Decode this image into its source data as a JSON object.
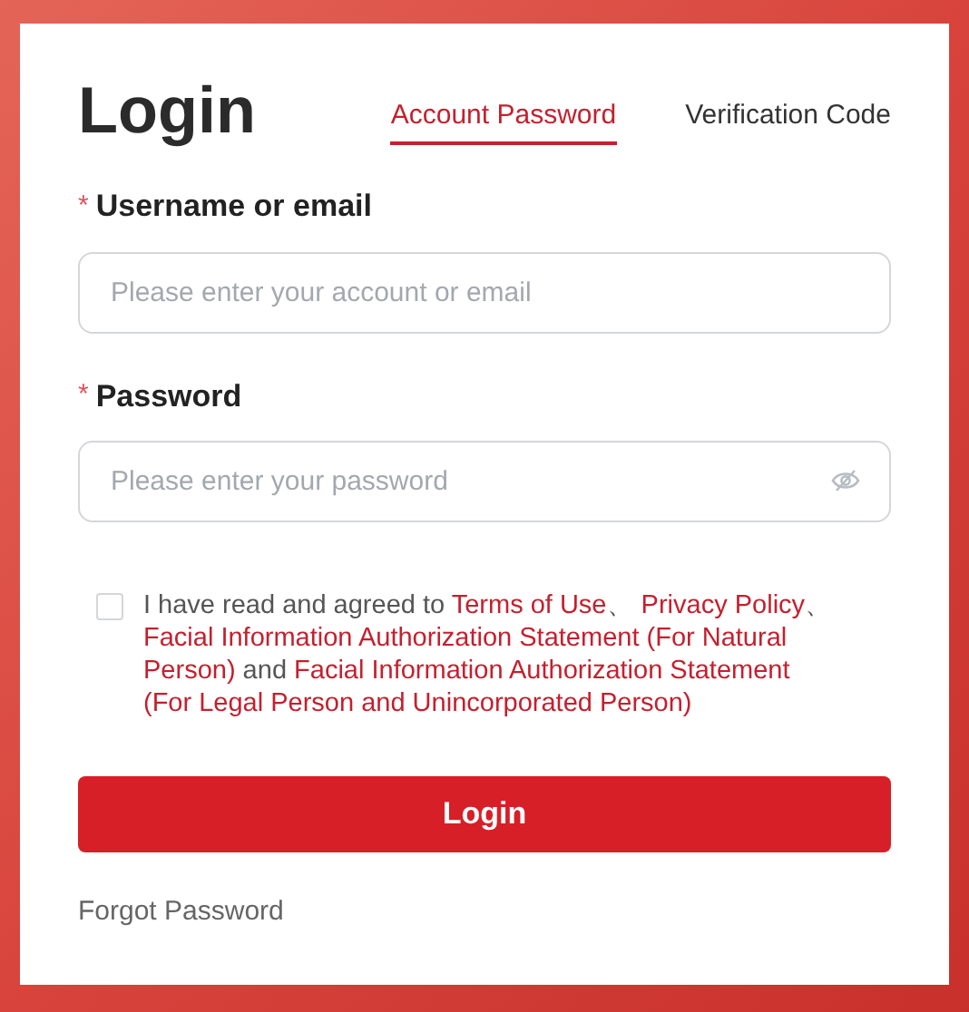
{
  "title": "Login",
  "tabs": [
    {
      "label": "Account Password",
      "selected": true
    },
    {
      "label": "Verification Code",
      "selected": false
    }
  ],
  "fields": [
    {
      "label": "Username or email",
      "required": true,
      "placeholder": "Please enter your account or email",
      "kind": "text"
    },
    {
      "label": "Password",
      "required": true,
      "placeholder": "Please enter your password",
      "kind": "password"
    }
  ],
  "required_mark": "*",
  "agreement": {
    "checked": false,
    "lines": [
      [
        {
          "kind": "text",
          "text": "I have read and agreed to "
        },
        {
          "kind": "link",
          "text": "Terms of Use"
        },
        {
          "kind": "text",
          "text": "、 "
        },
        {
          "kind": "link",
          "text": "Privacy Policy"
        },
        {
          "kind": "text",
          "text": "、"
        }
      ],
      [
        {
          "kind": "link",
          "text": "Facial Information Authorization Statement (For Natural"
        }
      ],
      [
        {
          "kind": "link",
          "text": "Person)"
        },
        {
          "kind": "text",
          "text": " and "
        },
        {
          "kind": "link",
          "text": "Facial Information Authorization Statement"
        }
      ],
      [
        {
          "kind": "link",
          "text": "(For Legal Person and Unincorporated Person)"
        }
      ]
    ]
  },
  "submit": "Login",
  "forgot": "Forgot Password"
}
